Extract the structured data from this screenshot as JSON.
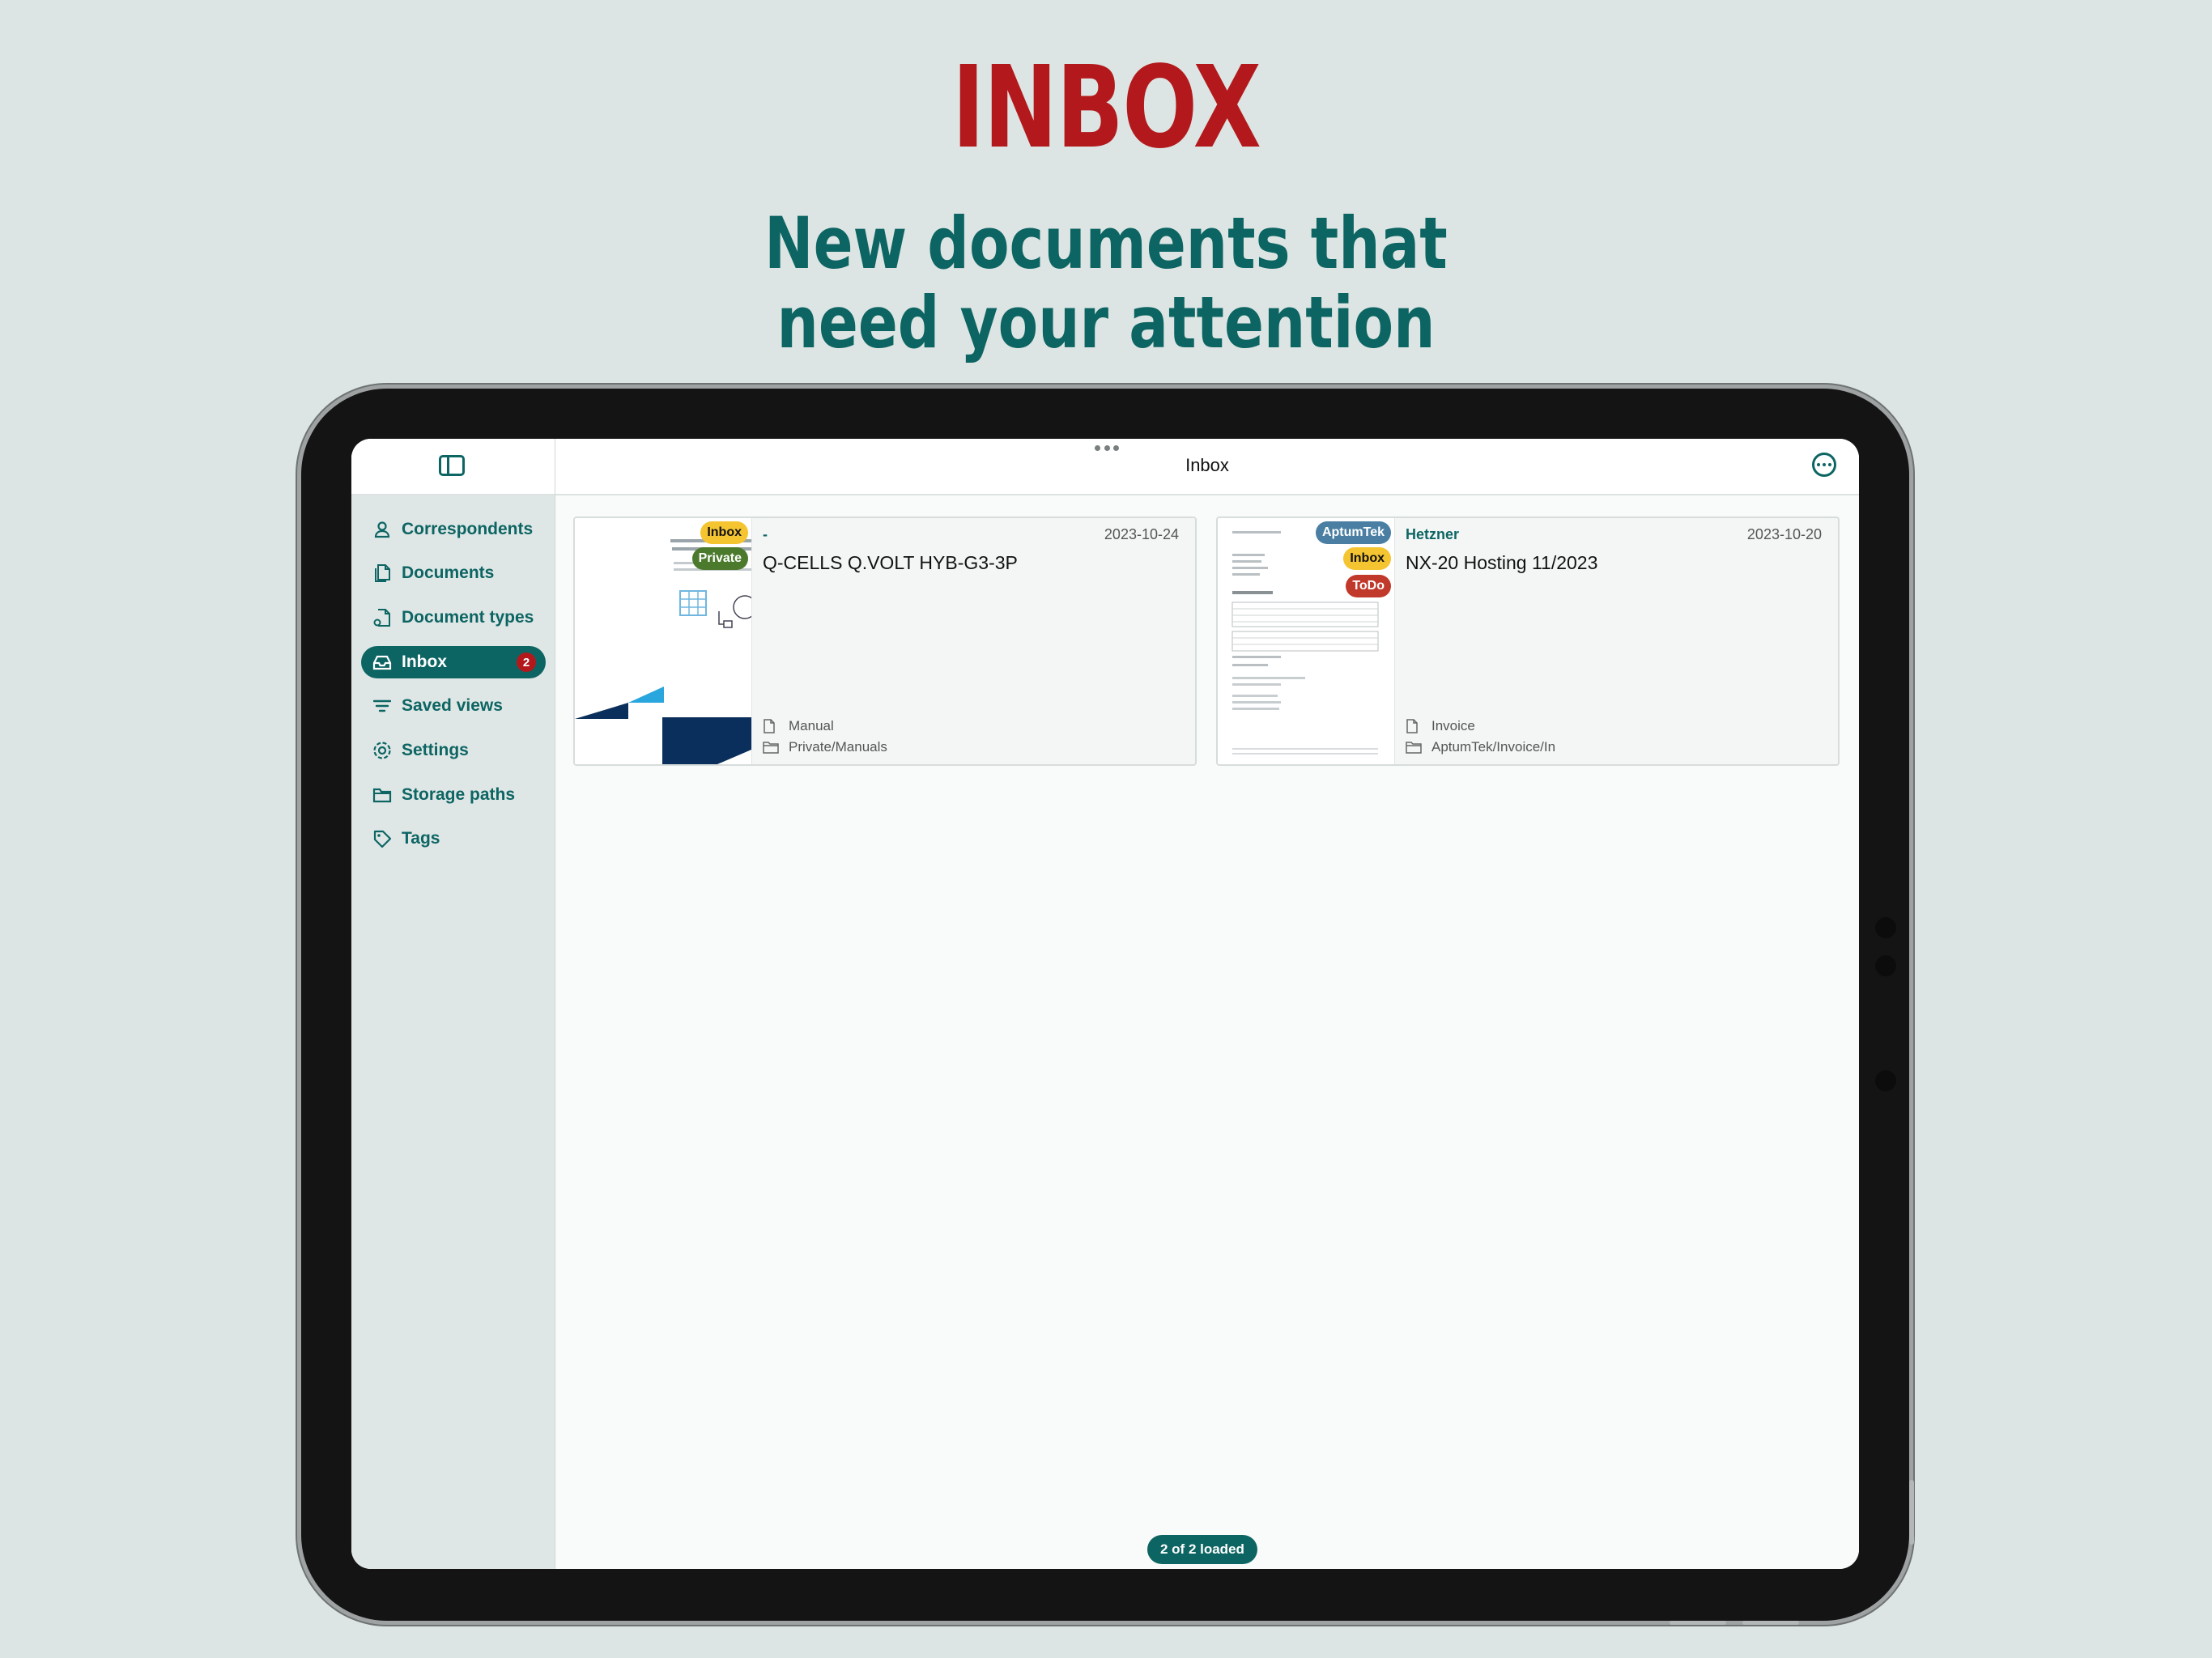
{
  "promo": {
    "headline": "INBOX",
    "subline_1": "New documents that",
    "subline_2": "need your attention"
  },
  "sidebar": {
    "items": [
      {
        "label": "Correspondents",
        "icon": "person-icon"
      },
      {
        "label": "Documents",
        "icon": "documents-icon"
      },
      {
        "label": "Document types",
        "icon": "document-types-icon"
      },
      {
        "label": "Inbox",
        "icon": "tray-icon",
        "badge": "2",
        "active": true
      },
      {
        "label": "Saved views",
        "icon": "filter-lines-icon"
      },
      {
        "label": "Settings",
        "icon": "gear-icon"
      },
      {
        "label": "Storage paths",
        "icon": "folder-icon"
      },
      {
        "label": "Tags",
        "icon": "tag-icon"
      }
    ]
  },
  "header": {
    "title": "Inbox"
  },
  "documents": [
    {
      "correspondent": "-",
      "date": "2023-10-24",
      "title": "Q-CELLS Q.VOLT HYB-G3-3P",
      "document_type": "Manual",
      "storage_path": "Private/Manuals",
      "tags": [
        {
          "label": "Inbox",
          "bg": "#f4c431",
          "fg": "#111111"
        },
        {
          "label": "Private",
          "bg": "#4b7a2c",
          "fg": "#ffffff"
        }
      ]
    },
    {
      "correspondent": "Hetzner",
      "date": "2023-10-20",
      "title": "NX-20 Hosting 11/2023",
      "document_type": "Invoice",
      "storage_path": "AptumTek/Invoice/In",
      "tags": [
        {
          "label": "AptumTek",
          "bg": "#4a7fa3",
          "fg": "#ffffff"
        },
        {
          "label": "Inbox",
          "bg": "#f4c431",
          "fg": "#111111"
        },
        {
          "label": "ToDo",
          "bg": "#c0392b",
          "fg": "#ffffff"
        }
      ]
    }
  ],
  "status": {
    "loaded": "2 of 2 loaded"
  },
  "colors": {
    "accent": "#0d6563",
    "headline": "#b3191c",
    "badge": "#b3191c"
  }
}
